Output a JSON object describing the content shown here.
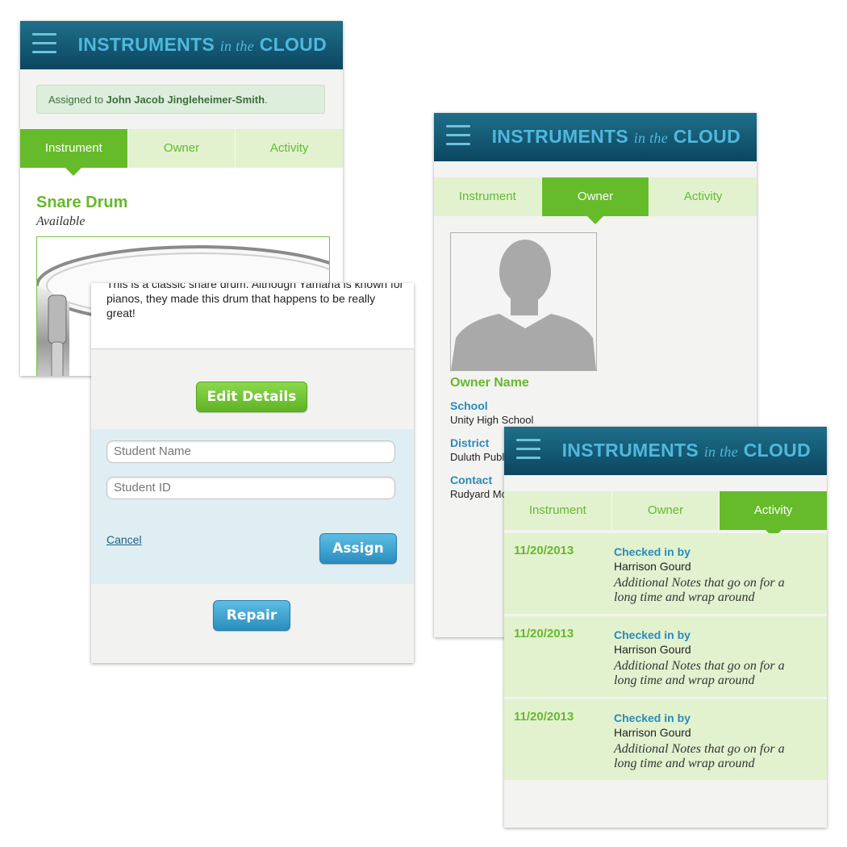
{
  "brand": {
    "main": "INSTRUMENTS",
    "italic": "in the",
    "end": "CLOUD"
  },
  "tabs": [
    "Instrument",
    "Owner",
    "Activity"
  ],
  "instrument_screen": {
    "notice_prefix": "Assigned to ",
    "notice_name": "John Jacob Jingleheimer-Smith",
    "notice_suffix": ".",
    "title": "Snare Drum",
    "status": "Available"
  },
  "assign_screen": {
    "description": "This is a classic snare drum. Although Yamaha is known for pianos, they made this drum that happens to be really great!",
    "edit_label": "Edit Details",
    "student_name_placeholder": "Student Name",
    "student_id_placeholder": "Student ID",
    "cancel_label": "Cancel",
    "assign_label": "Assign",
    "repair_label": "Repair"
  },
  "owner_screen": {
    "name": "Owner Name",
    "fields": [
      {
        "label": "School",
        "value": "Unity High School"
      },
      {
        "label": "District",
        "value": "Duluth Publ"
      },
      {
        "label": "Contact",
        "value": "Rudyard Mc"
      }
    ]
  },
  "activity_screen": {
    "entries": [
      {
        "date": "11/20/2013",
        "action": "Checked in by",
        "person": "Harrison Gourd",
        "note": "Additional Notes that go on for a long time and wrap around"
      },
      {
        "date": "11/20/2013",
        "action": "Checked in by",
        "person": "Harrison Gourd",
        "note": "Additional Notes that go on for a long time and wrap around"
      },
      {
        "date": "11/20/2013",
        "action": "Checked in by",
        "person": "Harrison Gourd",
        "note": "Additional Notes that go on for a long time and wrap around"
      }
    ]
  },
  "colors": {
    "header": "#0c4660",
    "brand": "#4fb8dc",
    "green": "#66bb2a",
    "tab_inactive": "#e2f2cf",
    "blue_label": "#2b8ab9"
  },
  "icons": [
    "menu-icon",
    "drum-image",
    "person-silhouette"
  ]
}
